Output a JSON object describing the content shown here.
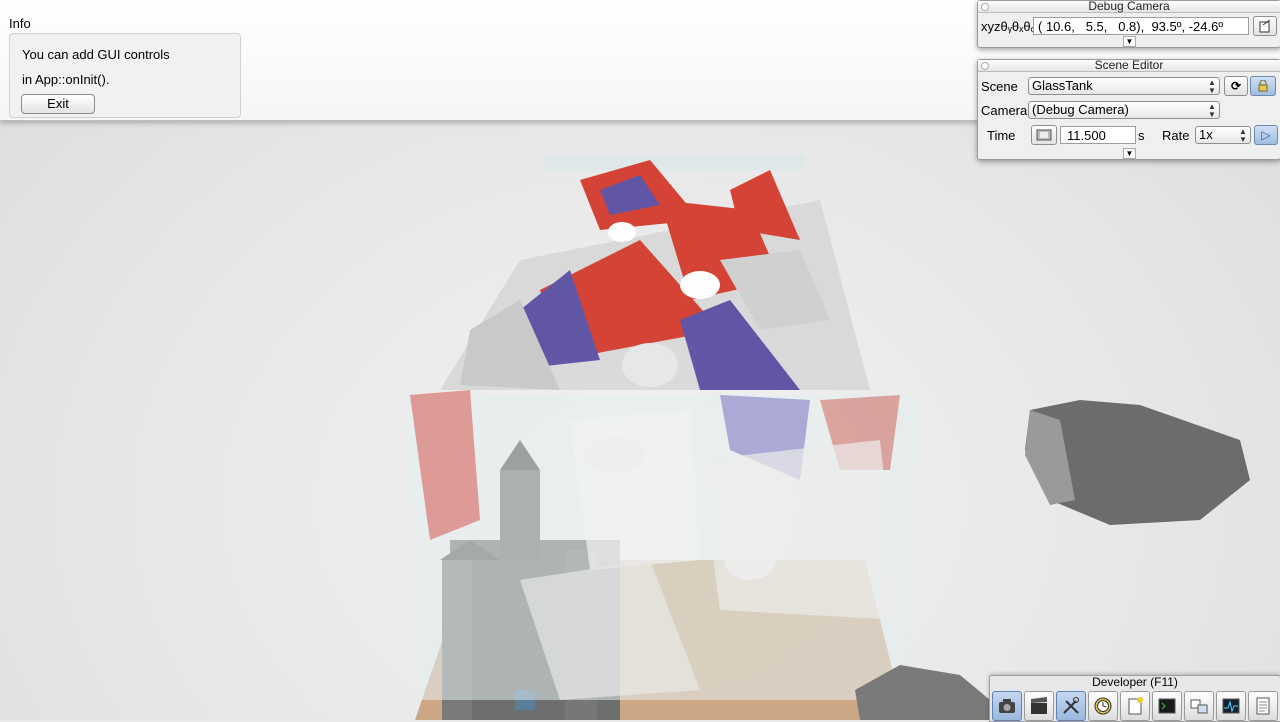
{
  "info": {
    "title": "Info",
    "line1": "You can add GUI controls",
    "line2": "in App::onInit().",
    "exit_label": "Exit"
  },
  "debug_camera": {
    "title": "Debug Camera",
    "label": "xyzθᵧθₓθᵩ",
    "value": "( 10.6,   5.5,   0.8),  93.5º, -24.6º"
  },
  "scene_editor": {
    "title": "Scene Editor",
    "scene_label": "Scene",
    "scene_value": "GlassTank",
    "camera_label": "Camera",
    "camera_value": "(Debug Camera)",
    "time_label": "Time",
    "time_value": "11.500",
    "time_unit": "s",
    "rate_label": "Rate",
    "rate_value": "1x"
  },
  "developer": {
    "title": "Developer (F11)",
    "tools": [
      "camera-icon",
      "film-clapper-icon",
      "tools-icon",
      "clock-icon",
      "new-document-icon",
      "console-icon",
      "windows-icon",
      "profiler-icon",
      "log-icon"
    ]
  },
  "colors": {
    "accent_blue": "#9ab7dd",
    "red_panes": "#d33a2c",
    "blue_panes": "#5a4fa3"
  }
}
